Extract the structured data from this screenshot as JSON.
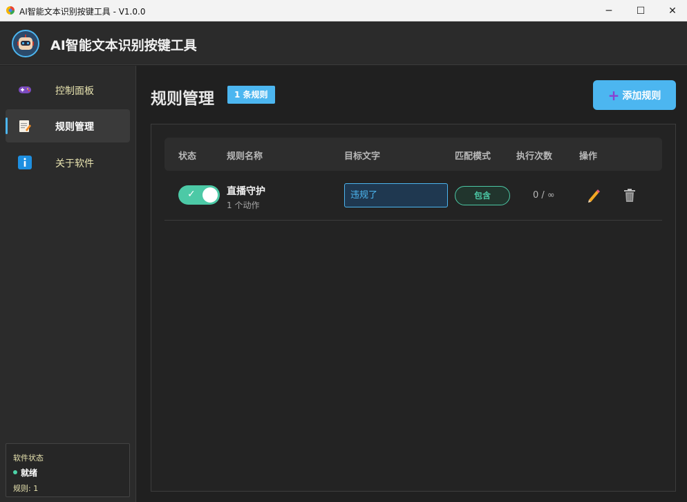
{
  "window": {
    "title": "AI智能文本识别按键工具 - V1.0.0",
    "controls": {
      "minimize": "─",
      "maximize": "☐",
      "close": "✕"
    }
  },
  "header": {
    "app_title": "AI智能文本识别按键工具",
    "logo_icon": "robot-icon"
  },
  "sidebar": {
    "items": [
      {
        "label": "控制面板",
        "icon": "gamepad-icon",
        "active": false
      },
      {
        "label": "规则管理",
        "icon": "memo-icon",
        "active": true
      },
      {
        "label": "关于软件",
        "icon": "info-icon",
        "active": false
      }
    ],
    "status": {
      "title": "软件状态",
      "value": "就绪",
      "rules": "规则: 1"
    }
  },
  "main": {
    "title": "规则管理",
    "count_badge": "1 条规则",
    "add_button": "添加规则",
    "table": {
      "headers": [
        "状态",
        "规则名称",
        "目标文字",
        "匹配模式",
        "执行次数",
        "操作"
      ],
      "rows": [
        {
          "enabled": true,
          "name": "直播守护",
          "subtitle": "1 个动作",
          "target_text": "违规了",
          "match_mode": "包含",
          "exec_count": "0 / ∞"
        }
      ]
    }
  },
  "colors": {
    "accent": "#4cb6f0",
    "success": "#4cc9a6",
    "sidebar_text": "#e9e4b0"
  }
}
